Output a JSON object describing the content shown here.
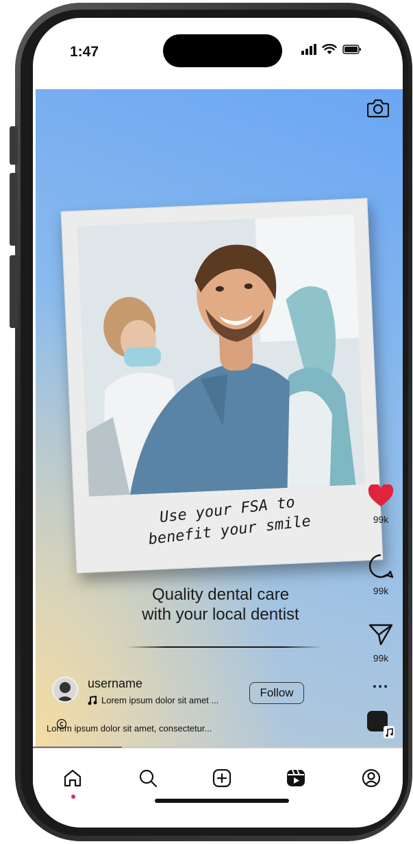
{
  "status_bar": {
    "time": "1:47"
  },
  "post": {
    "image_text_line1": "Use your FSA to",
    "image_text_line2": "benefit your smile",
    "caption_line1": "Quality dental care",
    "caption_line2": "with your local dentist",
    "username": "username",
    "music": "Lorem ipsum dolor sit amet ...",
    "follow_label": "Follow",
    "description": "Lorem ipsum dolor sit amet, consectetur..."
  },
  "actions": {
    "likes": "99k",
    "comments": "99k",
    "shares": "99k",
    "more_label": "..."
  },
  "icons": {
    "camera": "camera-icon",
    "like": "heart-icon",
    "comment": "comment-icon",
    "share": "send-icon",
    "more": "more-icon",
    "home": "home-icon",
    "search": "search-icon",
    "create": "plus-square-icon",
    "reels": "reels-icon",
    "profile": "profile-icon"
  },
  "colors": {
    "like_red": "#e0243c",
    "active_dot": "#e0245e",
    "background_top": "#6aa6f4",
    "background_bottom_left": "#f7dda0"
  },
  "video_progress": 0.24
}
